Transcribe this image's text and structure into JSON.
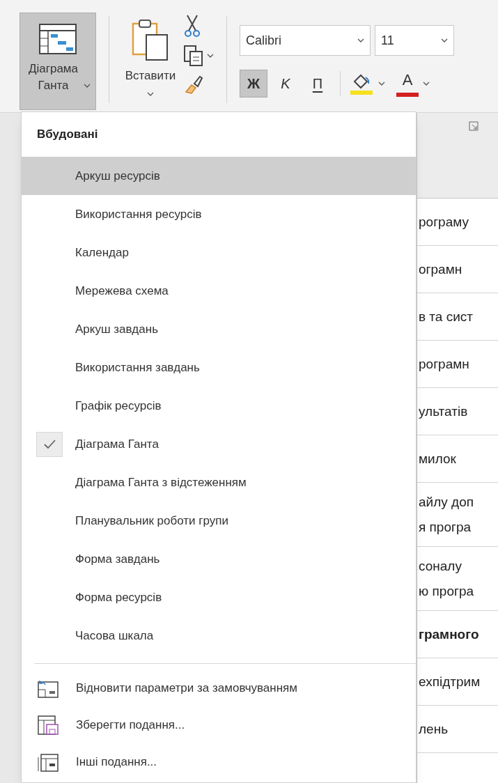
{
  "ribbon": {
    "view_button": {
      "label": "Діаграма Ганта",
      "expanded": true
    },
    "paste_button": {
      "label": "Вставити"
    },
    "font": {
      "name": "Calibri",
      "size": "11"
    },
    "format_buttons": [
      {
        "kind": "bold",
        "label": "Ж",
        "selected": true
      },
      {
        "kind": "italic",
        "label": "K",
        "selected": false
      },
      {
        "kind": "underline",
        "label": "П",
        "selected": false
      }
    ],
    "font_color_button": {
      "label": "A"
    }
  },
  "menu": {
    "section_title": "Вбудовані",
    "items": [
      {
        "label": "Аркуш ресурсів",
        "selected": true,
        "checked": false
      },
      {
        "label": "Використання ресурсів",
        "selected": false,
        "checked": false
      },
      {
        "label": "Календар",
        "selected": false,
        "checked": false
      },
      {
        "label": "Мережева схема",
        "selected": false,
        "checked": false
      },
      {
        "label": "Аркуш завдань",
        "selected": false,
        "checked": false
      },
      {
        "label": "Використання завдань",
        "selected": false,
        "checked": false
      },
      {
        "label": "Графік ресурсів",
        "selected": false,
        "checked": false
      },
      {
        "label": "Діаграма Ганта",
        "selected": false,
        "checked": true
      },
      {
        "label": "Діаграма Ганта з відстеженням",
        "selected": false,
        "checked": false
      },
      {
        "label": "Планувальник роботи групи",
        "selected": false,
        "checked": false
      },
      {
        "label": "Форма завдань",
        "selected": false,
        "checked": false
      },
      {
        "label": "Форма ресурсів",
        "selected": false,
        "checked": false
      },
      {
        "label": "Часова шкала",
        "selected": false,
        "checked": false
      }
    ],
    "actions": [
      {
        "kind": "reset",
        "label": "Відновити параметри за замовчуванням"
      },
      {
        "kind": "save",
        "label": "Зберегти подання..."
      },
      {
        "kind": "more",
        "label": "Інші подання..."
      }
    ]
  },
  "sheet": {
    "rows": [
      {
        "lines": [
          "рограму"
        ],
        "bold": false
      },
      {
        "lines": [
          "ограмн"
        ],
        "bold": false
      },
      {
        "lines": [
          "в та сист"
        ],
        "bold": false
      },
      {
        "lines": [
          "рограмн"
        ],
        "bold": false
      },
      {
        "lines": [
          "ультатів"
        ],
        "bold": false
      },
      {
        "lines": [
          "милок"
        ],
        "bold": false
      },
      {
        "lines": [
          "айлу доп",
          "я програ"
        ],
        "bold": false
      },
      {
        "lines": [
          "соналу",
          "ю програ"
        ],
        "bold": false
      },
      {
        "lines": [
          "грамного"
        ],
        "bold": true
      },
      {
        "lines": [
          "ехпідтрим"
        ],
        "bold": false
      },
      {
        "lines": [
          "лень"
        ],
        "bold": false
      }
    ]
  }
}
